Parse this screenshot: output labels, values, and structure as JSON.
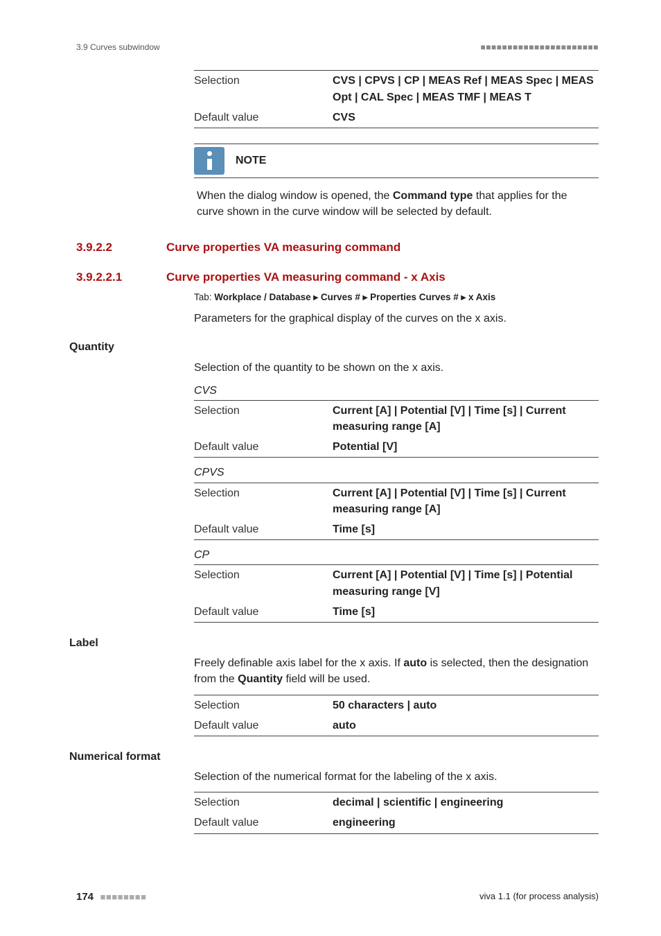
{
  "header": {
    "breadcrumb": "3.9 Curves subwindow",
    "dashes": "■■■■■■■■■■■■■■■■■■■■■■"
  },
  "command_type_table": {
    "selection_key": "Selection",
    "selection_val": "CVS | CPVS | CP | MEAS Ref | MEAS Spec | MEAS Opt | CAL Spec | MEAS TMF | MEAS T",
    "default_key": "Default value",
    "default_val": "CVS"
  },
  "note": {
    "title": "NOTE",
    "body_pre": "When the dialog window is opened, the ",
    "body_bold": "Command type",
    "body_post": " that applies for the curve shown in the curve window will be selected by default."
  },
  "s_3_9_2_2": {
    "num": "3.9.2.2",
    "title": "Curve properties VA measuring command"
  },
  "s_3_9_2_2_1": {
    "num": "3.9.2.2.1",
    "title": "Curve properties VA measuring command - x Axis",
    "tab_label": "Tab: ",
    "tab_text": "Workplace / Database ▸ Curves # ▸ Properties Curves # ▸ x Axis",
    "intro": "Parameters for the graphical display of the curves on the x axis."
  },
  "quantity": {
    "name": "Quantity",
    "desc": "Selection of the quantity to be shown on the x axis.",
    "cvs": {
      "title": "CVS",
      "selection_key": "Selection",
      "selection_val": "Current [A] | Potential [V] | Time [s] | Current measuring range [A]",
      "default_key": "Default value",
      "default_val": "Potential [V]"
    },
    "cpvs": {
      "title": "CPVS",
      "selection_key": "Selection",
      "selection_val": "Current [A] | Potential [V] | Time [s] | Current measuring range [A]",
      "default_key": "Default value",
      "default_val": "Time [s]"
    },
    "cp": {
      "title": "CP",
      "selection_key": "Selection",
      "selection_val": "Current [A] | Potential [V] | Time [s] | Potential measuring range [V]",
      "default_key": "Default value",
      "default_val": "Time [s]"
    }
  },
  "label_param": {
    "name": "Label",
    "desc_pre": "Freely definable axis label for the x axis. If ",
    "desc_b1": "auto",
    "desc_mid": " is selected, then the designation from the ",
    "desc_b2": "Quantity",
    "desc_post": " field will be used.",
    "selection_key": "Selection",
    "selection_val": "50 characters | auto",
    "default_key": "Default value",
    "default_val": "auto"
  },
  "numformat": {
    "name": "Numerical format",
    "desc": "Selection of the numerical format for the labeling of the x axis.",
    "selection_key": "Selection",
    "selection_val": "decimal | scientific | engineering",
    "default_key": "Default value",
    "default_val": "engineering"
  },
  "footer": {
    "page": "174",
    "dashes": "■■■■■■■■",
    "right": "viva 1.1 (for process analysis)"
  }
}
